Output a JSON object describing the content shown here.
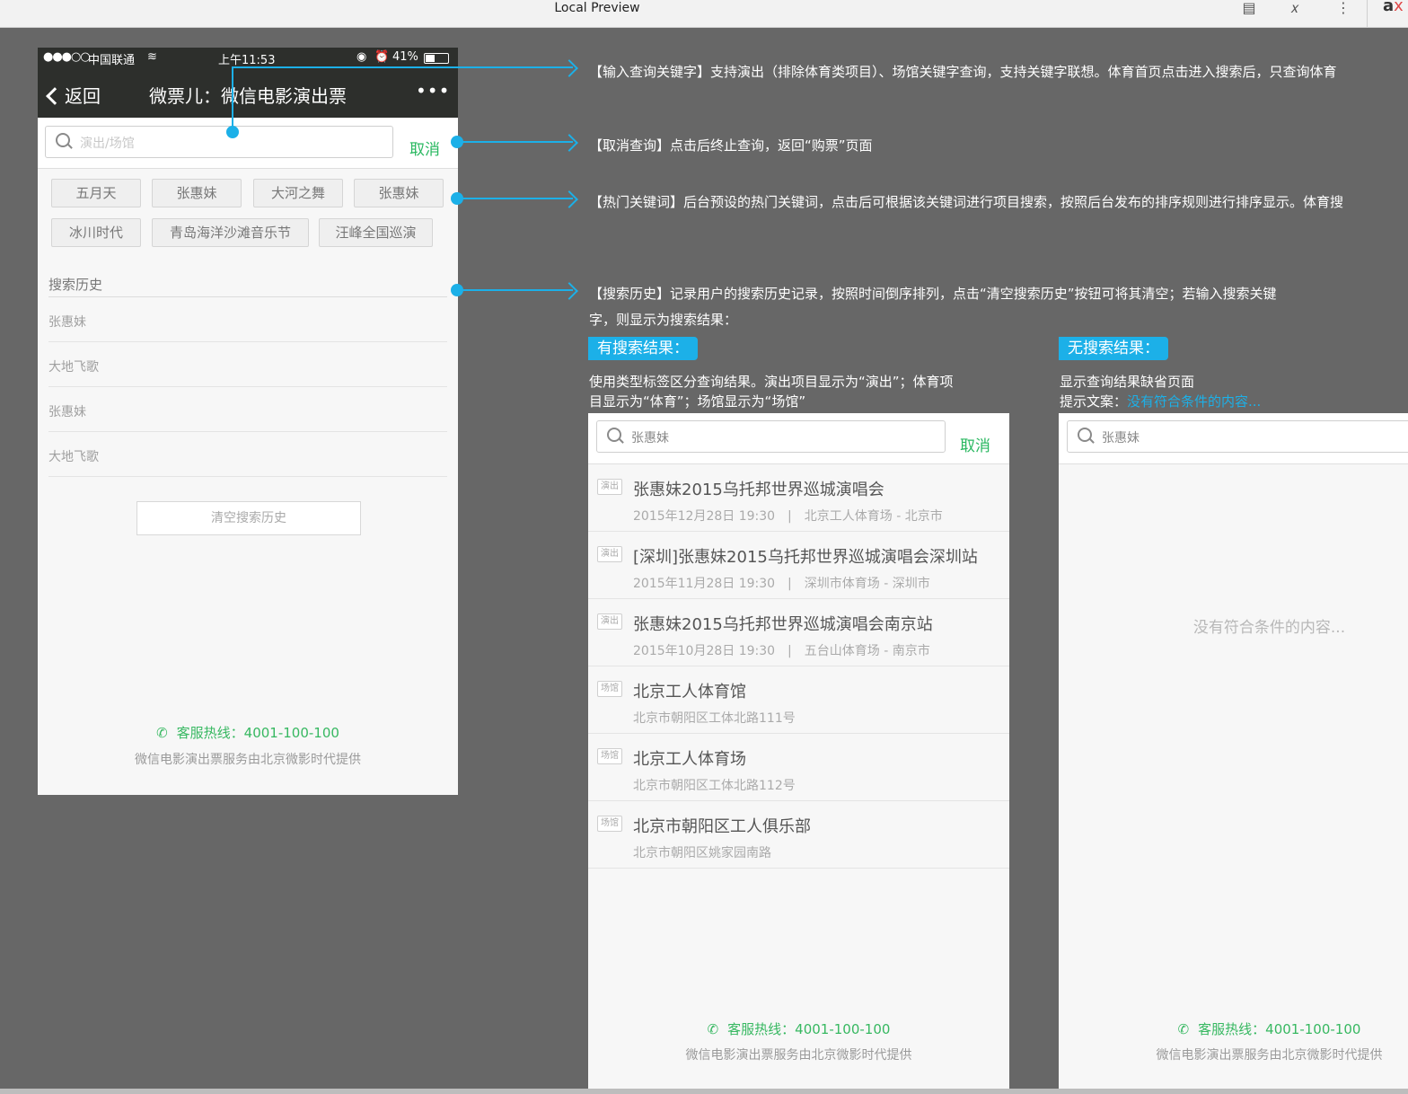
{
  "window": {
    "title": "Local Preview",
    "logo_main": "a",
    "logo_accent": "x"
  },
  "phone": {
    "status": {
      "dots": "●●●○○",
      "carrier": "中国联通",
      "time": "上午11:53",
      "battery": "41%"
    },
    "nav": {
      "back": "返回",
      "title": "微票儿：微信电影演出票",
      "more": "•••"
    },
    "search": {
      "placeholder": "演出/场馆",
      "cancel": "取消"
    },
    "hot_tags": [
      "五月天",
      "张惠妹",
      "大河之舞",
      "张惠妹",
      "冰川时代",
      "青岛海洋沙滩音乐节",
      "汪峰全国巡演"
    ],
    "history_title": "搜索历史",
    "history": [
      "张惠妹",
      "大地飞歌",
      "张惠妹",
      "大地飞歌"
    ],
    "clear_button": "清空搜索历史",
    "hotline": "客服热线：4001-100-100",
    "footer_note": "微信电影演出票服务由北京微影时代提供"
  },
  "annotations": {
    "a1": "【输入查询关键字】支持演出（排除体育类项目）、场馆关键字查询，支持关键字联想。体育首页点击进入搜索后，只查询体育",
    "a2": "【取消查询】点击后终止查询，返回“购票”页面",
    "a3": "【热门关键词】后台预设的热门关键词，点击后可根据该关键词进行项目搜索，按照后台发布的排序规则进行排序显示。体育搜",
    "a4_line1": "【搜索历史】记录用户的搜索历史记录，按照时间倒序排列，点击“清空搜索历史”按钮可将其清空；若输入搜索关键",
    "a4_line2": "字，则显示为搜索结果："
  },
  "with_results": {
    "badge": "有搜索结果：",
    "desc_line1": "使用类型标签区分查询结果。演出项目显示为“演出”；体育项",
    "desc_line2": "目显示为“体育”；场馆显示为“场馆”",
    "query": "张惠妹",
    "cancel": "取消",
    "items": [
      {
        "type": "演出",
        "name": "张惠妹2015乌托邦世界巡城演唱会",
        "sub": "2015年12月28日 19:30　|　北京工人体育场 - 北京市"
      },
      {
        "type": "演出",
        "name": "[深圳]张惠妹2015乌托邦世界巡城演唱会深圳站",
        "sub": "2015年11月28日 19:30　|　深圳市体育场 - 深圳市"
      },
      {
        "type": "演出",
        "name": "张惠妹2015乌托邦世界巡城演唱会南京站",
        "sub": "2015年10月28日 19:30　|　五台山体育场 - 南京市"
      },
      {
        "type": "场馆",
        "name": "北京工人体育馆",
        "sub": "北京市朝阳区工体北路111号"
      },
      {
        "type": "场馆",
        "name": "北京工人体育场",
        "sub": "北京市朝阳区工体北路112号"
      },
      {
        "type": "场馆",
        "name": "北京市朝阳区工人俱乐部",
        "sub": "北京市朝阳区姚家园南路"
      }
    ],
    "hotline": "客服热线：4001-100-100",
    "footer_note": "微信电影演出票服务由北京微影时代提供"
  },
  "no_results": {
    "badge": "无搜索结果：",
    "desc_line1": "显示查询结果缺省页面",
    "desc_prefix": "提示文案：",
    "desc_link": "没有符合条件的内容...",
    "query": "张惠妹",
    "empty_text": "没有符合条件的内容...",
    "hotline": "客服热线：4001-100-100",
    "footer_note": "微信电影演出票服务由北京微影时代提供"
  },
  "colors": {
    "accent_blue": "#1cb0e8",
    "green": "#29b860",
    "nav_dark": "#2d2f2c",
    "canvas": "#676767"
  }
}
